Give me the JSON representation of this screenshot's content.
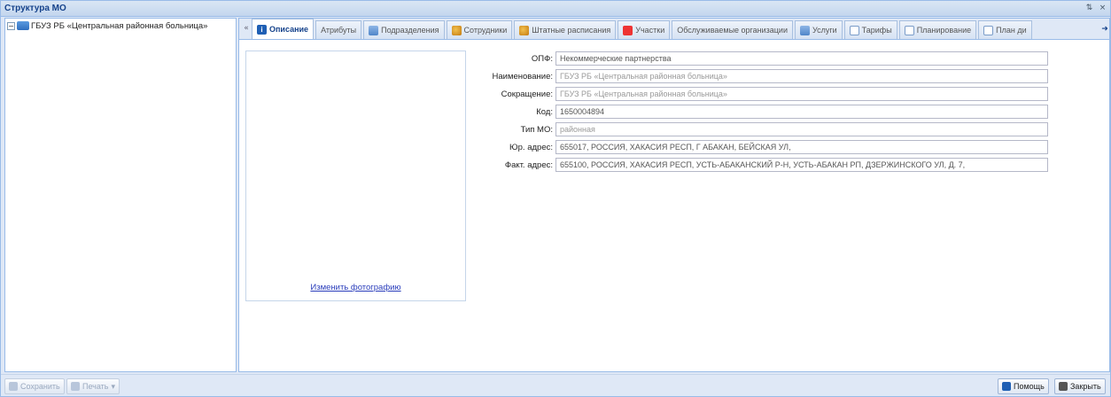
{
  "window": {
    "title": "Структура МО",
    "tools": [
      "⇅",
      "×"
    ]
  },
  "tree": {
    "root": {
      "expander": "−",
      "label": "ГБУЗ РБ «Центральная районная больница»"
    }
  },
  "tabs": [
    {
      "label": "Описание",
      "icon": "info-icon",
      "active": true
    },
    {
      "label": "Атрибуты",
      "icon": "",
      "active": false
    },
    {
      "label": "Подразделения",
      "icon": "grid-icon",
      "active": false
    },
    {
      "label": "Сотрудники",
      "icon": "people-icon",
      "active": false
    },
    {
      "label": "Штатные расписания",
      "icon": "people-icon",
      "active": false
    },
    {
      "label": "Участки",
      "icon": "pin-icon",
      "active": false
    },
    {
      "label": "Обслуживаемые организации",
      "icon": "",
      "active": false
    },
    {
      "label": "Услуги",
      "icon": "service-icon",
      "active": false
    },
    {
      "label": "Тарифы",
      "icon": "doc-icon",
      "active": false
    },
    {
      "label": "Планирование",
      "icon": "doc-icon",
      "active": false
    },
    {
      "label": "План ди",
      "icon": "doc-icon",
      "active": false
    }
  ],
  "tab_scroll": {
    "left": "«",
    "right": "➜"
  },
  "photo": {
    "change_link": "Изменить фотографию"
  },
  "form": {
    "opf": {
      "label": "ОПФ:",
      "value": "Некоммерческие партнерства"
    },
    "name": {
      "label": "Наименование:",
      "value": "ГБУЗ РБ «Центральная районная больница»"
    },
    "short": {
      "label": "Сокращение:",
      "value": "ГБУЗ РБ «Центральная районная больница»"
    },
    "code": {
      "label": "Код:",
      "value": "1650004894"
    },
    "type": {
      "label": "Тип МО:",
      "value": "районная"
    },
    "legal_address": {
      "label": "Юр. адрес:",
      "value": "655017, РОССИЯ, ХАКАСИЯ РЕСП, Г АБАКАН, БЕЙСКАЯ УЛ,"
    },
    "actual_address": {
      "label": "Факт. адрес:",
      "value": "655100, РОССИЯ, ХАКАСИЯ РЕСП, УСТЬ-АБАКАНСКИЙ Р-Н, УСТЬ-АБАКАН РП, ДЗЕРЖИНСКОГО УЛ, Д. 7,"
    }
  },
  "footer": {
    "save": "Сохранить",
    "print": "Печать",
    "print_arrow": "▾",
    "help": "Помощь",
    "close": "Закрыть"
  }
}
